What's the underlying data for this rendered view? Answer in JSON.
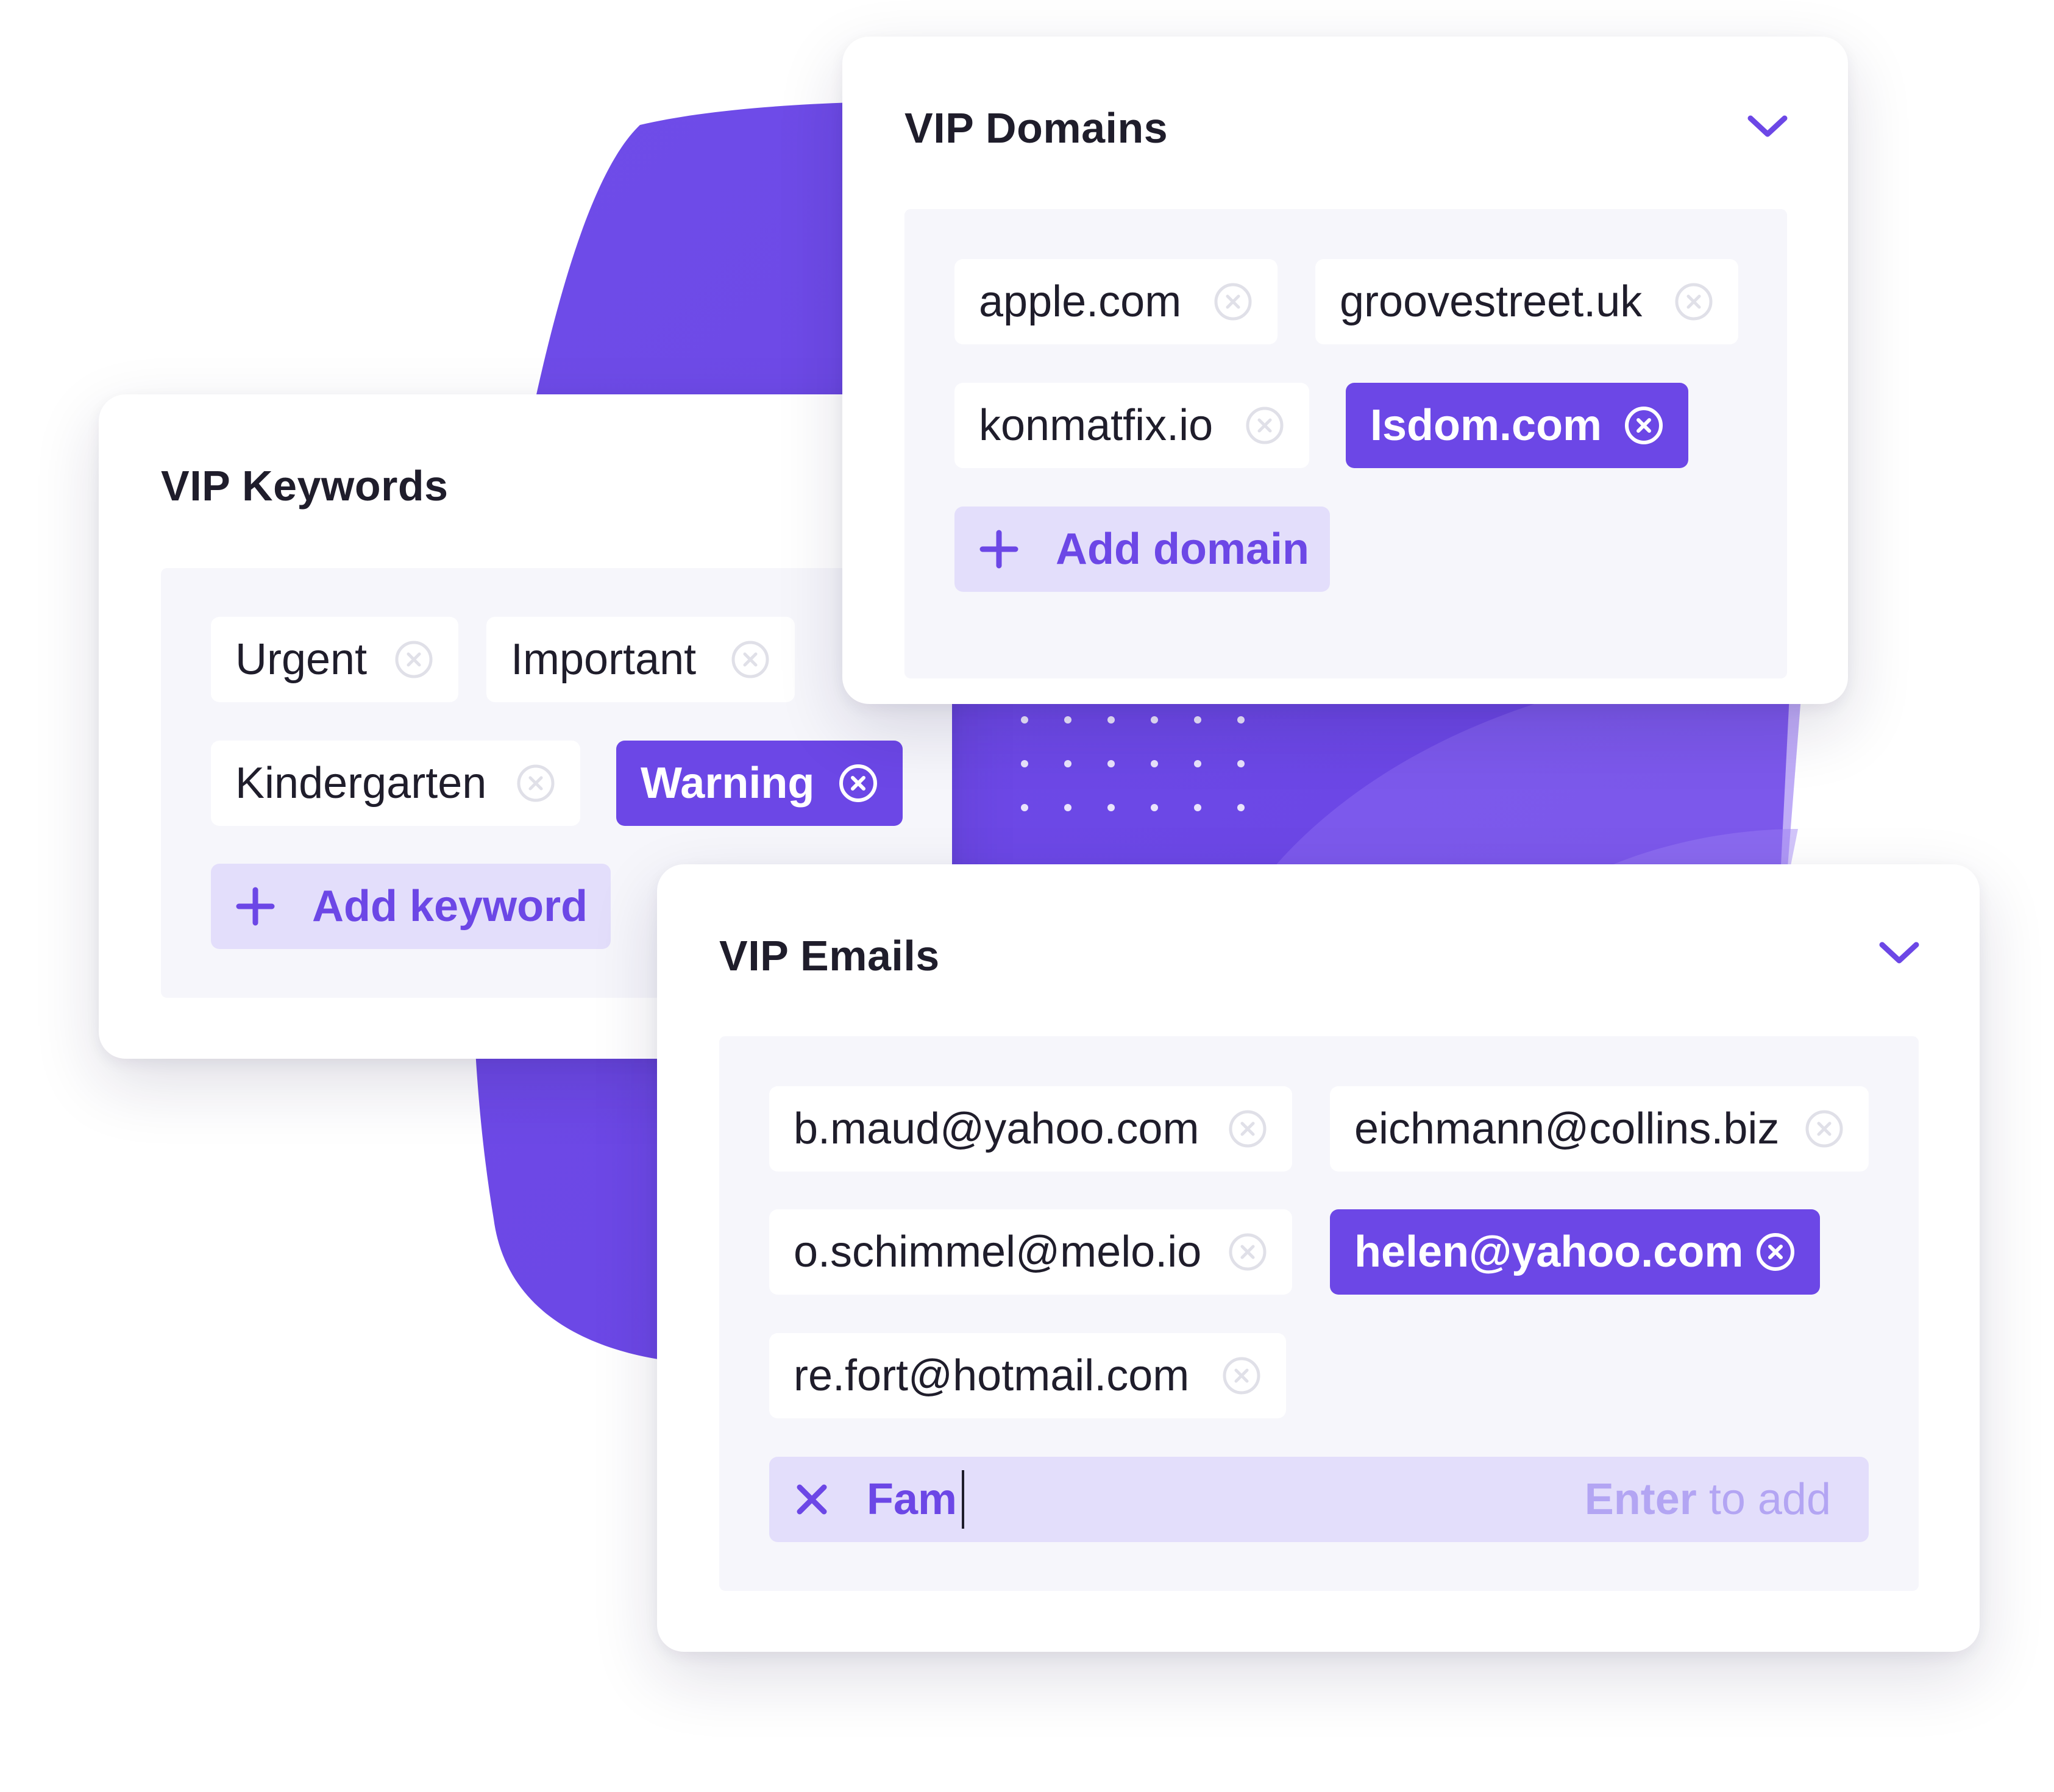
{
  "colors": {
    "accent": "#6c47e6",
    "accent_soft": "#e3defb",
    "panel": "#f6f6fb",
    "text": "#1f1d2b",
    "hint": "#b3a5f3"
  },
  "keywords": {
    "title": "VIP Keywords",
    "chips": [
      {
        "label": "Urgent",
        "active": false
      },
      {
        "label": "Important",
        "active": false
      },
      {
        "label": "Kindergarten",
        "active": false
      },
      {
        "label": "Warning",
        "active": true
      }
    ],
    "add_label": "Add keyword"
  },
  "domains": {
    "title": "VIP Domains",
    "chips": [
      {
        "label": "apple.com",
        "active": false
      },
      {
        "label": "groovestreet.uk",
        "active": false
      },
      {
        "label": "konmatfix.io",
        "active": false
      },
      {
        "label": "Isdom.com",
        "active": true
      }
    ],
    "add_label": "Add domain"
  },
  "emails": {
    "title": "VIP Emails",
    "chips": [
      {
        "label": "b.maud@yahoo.com",
        "active": false
      },
      {
        "label": "eichmann@collins.biz",
        "active": false
      },
      {
        "label": "o.schimmel@melo.io",
        "active": false
      },
      {
        "label": "helen@yahoo.com",
        "active": true
      },
      {
        "label": "re.fort@hotmail.com",
        "active": false
      }
    ],
    "input": {
      "value": "Fam",
      "hint_key": "Enter",
      "hint_rest": " to add"
    }
  }
}
